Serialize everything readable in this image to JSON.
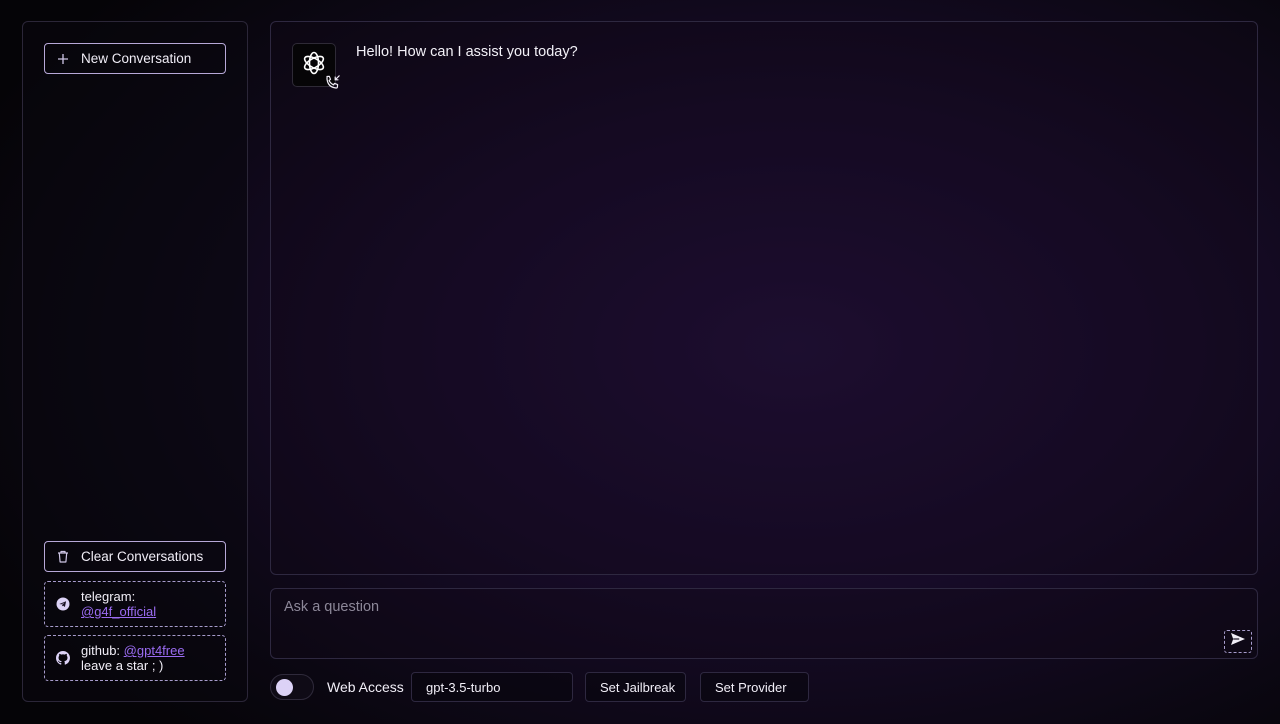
{
  "sidebar": {
    "new_conversation": "New Conversation",
    "clear_conversations": "Clear Conversations",
    "telegram": {
      "label": "telegram:",
      "handle": "@g4f_official"
    },
    "github": {
      "label": "github:",
      "handle": "@gpt4free",
      "note": "leave a star ; )"
    }
  },
  "chat": {
    "messages": [
      {
        "role": "assistant",
        "text": "Hello! How can I assist you today?"
      }
    ]
  },
  "composer": {
    "placeholder": "Ask a question"
  },
  "controls": {
    "web_access_label": "Web Access",
    "web_access_enabled": false,
    "model": "gpt-3.5-turbo",
    "jailbreak": "Set Jailbreak",
    "provider": "Set Provider"
  },
  "icons": {
    "new": "plus-icon",
    "clear": "trash-icon",
    "telegram": "telegram-icon",
    "github": "github-icon",
    "avatar": "openai-logo-icon",
    "call": "phone-incoming-icon",
    "send": "send-icon"
  },
  "colors": {
    "accent": "#9b6cf2",
    "border": "#b7a8d8",
    "toggle_knob": "#dcd2f6"
  }
}
